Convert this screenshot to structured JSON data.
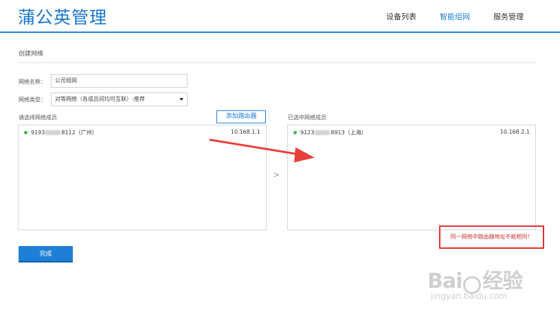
{
  "header": {
    "brand": "蒲公英管理",
    "nav": [
      {
        "label": "设备列表",
        "active": false
      },
      {
        "label": "智能组网",
        "active": true
      },
      {
        "label": "服务管理",
        "active": false
      }
    ]
  },
  "section": {
    "title": "创建网络"
  },
  "form": {
    "name_label": "网络名称：",
    "name_value": "公司组网",
    "type_label": "网络类型：",
    "type_value": "对等网络（各成员间均可互联）-推荐"
  },
  "left_panel": {
    "title": "请选择网络成员",
    "add_button": "添加路由器",
    "members": [
      {
        "id_prefix": "9193",
        "id_suffix": "8112（广州）",
        "ip": "10.168.1.1"
      }
    ]
  },
  "right_panel": {
    "title": "已选中网络成员",
    "members": [
      {
        "id_prefix": "9123",
        "id_suffix": "8913（上海）",
        "ip": "10.168.2.1"
      }
    ]
  },
  "transfer_icon": ">",
  "warning": "同一网络中路由器地址不能相同！",
  "done_button": "完成",
  "watermark": {
    "main_left": "Bai",
    "main_right": "经验",
    "url": "jingyan.baidu.com"
  },
  "colors": {
    "accent": "#1e7fd6",
    "online": "#3dbb3d",
    "warning": "#e82c2c",
    "arrow": "#e8403a"
  }
}
